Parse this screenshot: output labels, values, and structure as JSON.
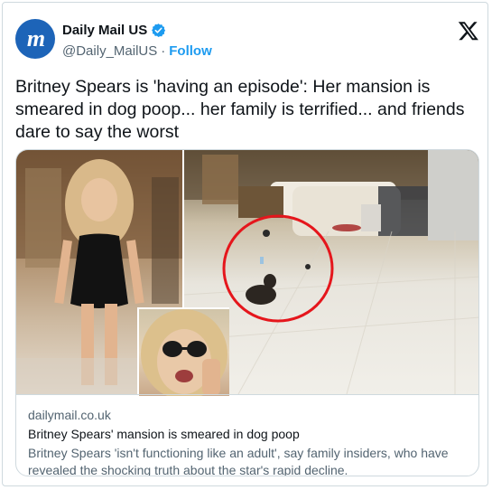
{
  "account": {
    "name": "Daily Mail US",
    "handle": "@Daily_MailUS",
    "separator": "·",
    "follow_label": "Follow",
    "avatar_letters": "m"
  },
  "tweet": {
    "text": "Britney Spears is 'having an episode': Her mansion is smeared in dog poop... her family is terrified... and friends dare to say the worst"
  },
  "link_card": {
    "domain": "dailymail.co.uk",
    "title": "Britney Spears' mansion is smeared in dog poop",
    "description": "Britney Spears 'isn't functioning like an adult', say family insiders, who have revealed the shocking truth about the star's rapid decline."
  },
  "colors": {
    "accent": "#1d9bf0",
    "avatar_bg": "#1d64b8",
    "highlight_circle": "#e5161c"
  },
  "icons": [
    "verified-badge-icon",
    "x-logo-icon"
  ]
}
